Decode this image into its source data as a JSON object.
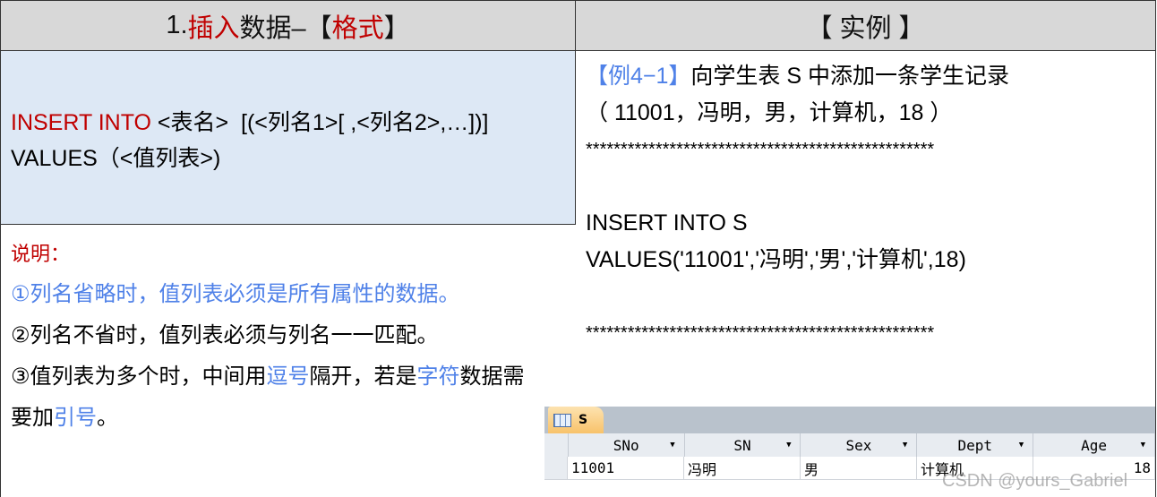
{
  "left_header": {
    "prefix": "1.",
    "red1": "插入",
    "mid": "数据–【 ",
    "red2": "格式",
    "suffix": " 】"
  },
  "right_header": "【 实例 】",
  "format": {
    "kw": "INSERT INTO",
    "line1_rest": " <表名>  [(<列名1>[ ,<列名2>,…])]",
    "line2": "VALUES（<值列表>)"
  },
  "notes": {
    "title": "说明：",
    "n1": "①列名省略时，值列表必须是所有属性的数据。",
    "n2": "②列名不省时，值列表必须与列名一一匹配。",
    "n3a": "③值列表为多个时，中间用",
    "n3b": "逗号",
    "n3c": "隔开，若是",
    "n3d": "字符",
    "n3e": "数据需",
    "n4a": "要加",
    "n4b": "引号",
    "n4c": "。"
  },
  "example": {
    "tag": "【例4−1】",
    "title": "向学生表 S 中添加一条学生记录",
    "data": "（ 11001，冯明，男，计算机，18 ）",
    "stars": "**************************************************",
    "sql1": "INSERT INTO S",
    "sql2": "VALUES('11001','冯明','男','计算机',18)"
  },
  "table": {
    "name": "S",
    "columns": [
      "SNo",
      "SN",
      "Sex",
      "Dept",
      "Age"
    ],
    "row": [
      "11001",
      "冯明",
      "男",
      "计算机",
      "18"
    ]
  },
  "watermark": "CSDN @yours_Gabriel"
}
